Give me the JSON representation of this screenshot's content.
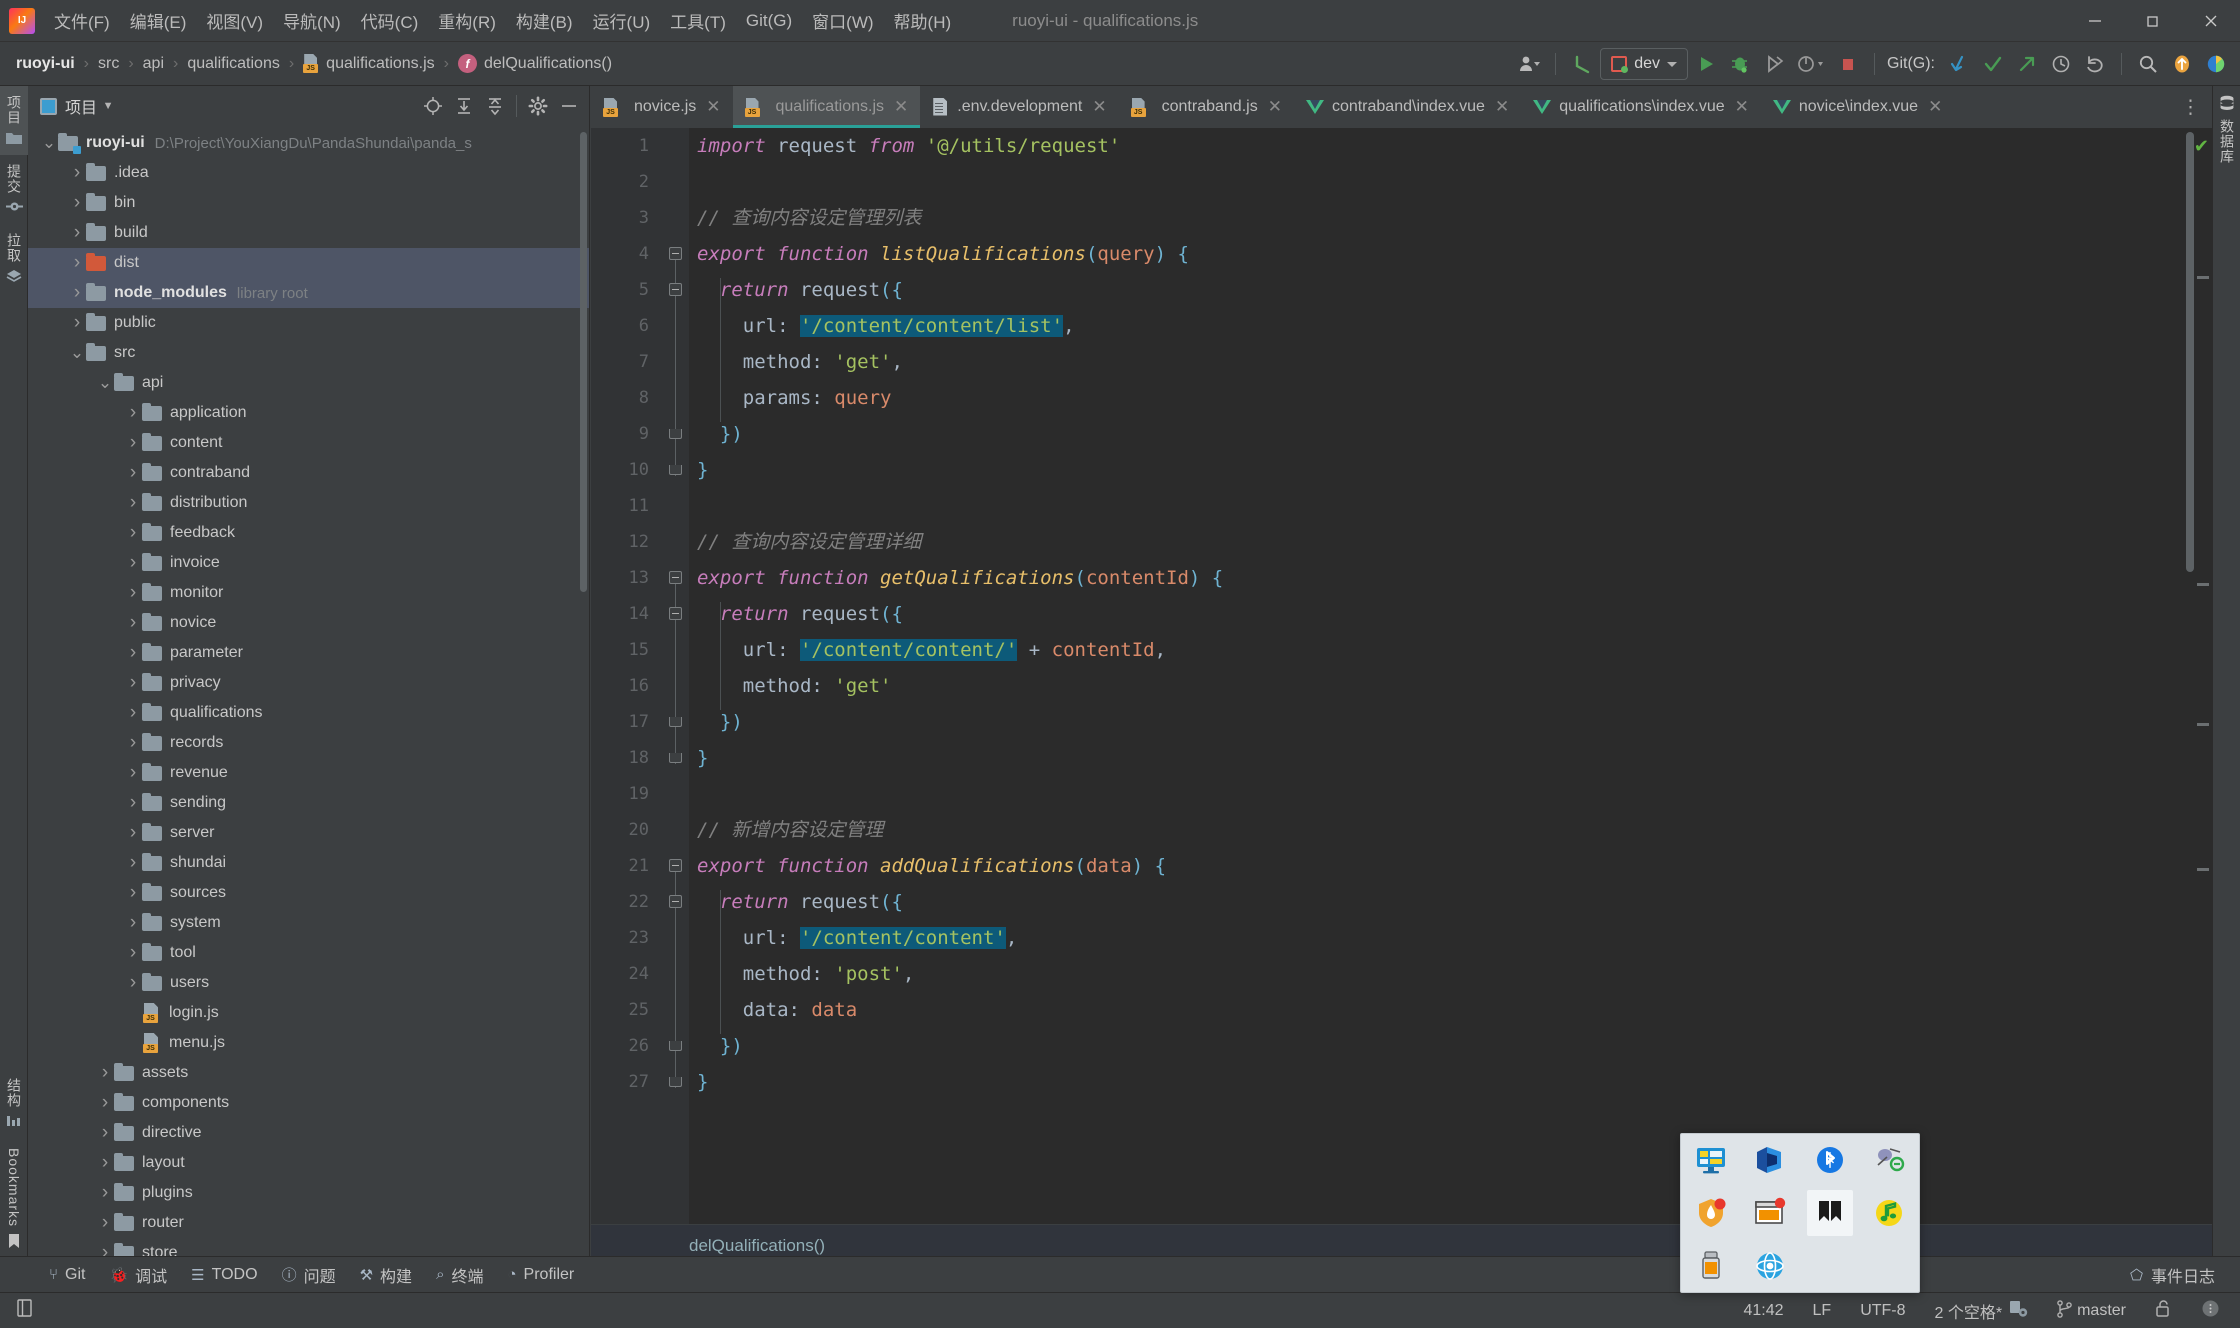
{
  "window": {
    "title": "ruoyi-ui - qualifications.js",
    "logo_icon": "intellij-idea-logo",
    "minimize_label": "–",
    "maximize_label": "❐",
    "close_label": "✕"
  },
  "menubar": {
    "items": [
      {
        "label": "文件(F)",
        "name": "menu-file"
      },
      {
        "label": "编辑(E)",
        "name": "menu-edit"
      },
      {
        "label": "视图(V)",
        "name": "menu-view"
      },
      {
        "label": "导航(N)",
        "name": "menu-navigate"
      },
      {
        "label": "代码(C)",
        "name": "menu-code"
      },
      {
        "label": "重构(R)",
        "name": "menu-refactor"
      },
      {
        "label": "构建(B)",
        "name": "menu-build"
      },
      {
        "label": "运行(U)",
        "name": "menu-run"
      },
      {
        "label": "工具(T)",
        "name": "menu-tools"
      },
      {
        "label": "Git(G)",
        "name": "menu-git"
      },
      {
        "label": "窗口(W)",
        "name": "menu-window"
      },
      {
        "label": "帮助(H)",
        "name": "menu-help"
      }
    ]
  },
  "breadcrumb": {
    "items": [
      {
        "label": "ruoyi-ui",
        "name": "breadcrumb-project",
        "bold": true
      },
      {
        "label": "src",
        "name": "breadcrumb-src"
      },
      {
        "label": "api",
        "name": "breadcrumb-api"
      },
      {
        "label": "qualifications",
        "name": "breadcrumb-qualifications"
      },
      {
        "label": "qualifications.js",
        "name": "breadcrumb-file"
      },
      {
        "label": "delQualifications()",
        "name": "breadcrumb-function"
      }
    ],
    "separator": "›"
  },
  "toolbar": {
    "run_config": "dev",
    "git_label": "Git(G):",
    "icons": {
      "account": "user-account-icon",
      "back_arrow": "back-arrow-icon",
      "run": "run-icon",
      "debug": "debug-icon",
      "coverage": "run-with-coverage-icon",
      "profile": "profile-icon",
      "stop": "stop-icon",
      "update": "git-update-icon",
      "commit": "git-commit-icon",
      "push": "git-push-icon",
      "history": "git-history-icon",
      "rollback": "git-rollback-icon",
      "search": "search-everywhere-icon",
      "updates": "updates-available-icon",
      "ai": "ai-assistant-icon"
    }
  },
  "left_strip": {
    "tabs": [
      {
        "label": "项目",
        "name": "tool-tab-project",
        "icon": "project-folder-icon",
        "active": true
      },
      {
        "label": "提交",
        "name": "tool-tab-commit",
        "icon": "commit-icon",
        "active": false
      },
      {
        "label": "拉取",
        "name": "tool-tab-pull-requests",
        "icon": "pull-requests-icon",
        "active": false
      }
    ],
    "bottom_tabs": [
      {
        "label": "结构",
        "name": "tool-tab-structure",
        "icon": "structure-icon"
      },
      {
        "label": "Bookmarks",
        "name": "tool-tab-bookmarks",
        "icon": "bookmark-icon"
      }
    ]
  },
  "right_strip": {
    "tabs": [
      {
        "label": "数据库",
        "name": "tool-tab-database",
        "icon": "database-icon"
      }
    ]
  },
  "project_panel": {
    "title": "项目",
    "icon": "project-panel-icon",
    "dropdown_icon": "chevron-down-icon",
    "actions": [
      {
        "name": "scroll-from-source-button",
        "icon": "target-icon",
        "glyph": "⊕"
      },
      {
        "name": "expand-all-button",
        "icon": "expand-all-icon",
        "glyph": "⤓"
      },
      {
        "name": "collapse-all-button",
        "icon": "collapse-all-icon",
        "glyph": "⤒"
      },
      {
        "name": "panel-settings-button",
        "icon": "gear-icon",
        "glyph": "⚙"
      },
      {
        "name": "hide-panel-button",
        "icon": "minimize-icon",
        "glyph": "—"
      }
    ],
    "tree": [
      {
        "label": "ruoyi-ui",
        "suffix": "D:\\Project\\YouXiangDu\\PandaShundai\\panda_s",
        "indent": 0,
        "arrow": "expanded",
        "icon": "project-root-folder",
        "bold": true
      },
      {
        "label": ".idea",
        "indent": 1,
        "arrow": "collapsed",
        "icon": "folder"
      },
      {
        "label": "bin",
        "indent": 1,
        "arrow": "collapsed",
        "icon": "folder"
      },
      {
        "label": "build",
        "indent": 1,
        "arrow": "collapsed",
        "icon": "folder"
      },
      {
        "label": "dist",
        "indent": 1,
        "arrow": "collapsed",
        "icon": "folder-excluded",
        "selected": true
      },
      {
        "label": "node_modules",
        "suffix": "library root",
        "indent": 1,
        "arrow": "collapsed",
        "icon": "folder",
        "bold": true,
        "selected": true
      },
      {
        "label": "public",
        "indent": 1,
        "arrow": "collapsed",
        "icon": "folder"
      },
      {
        "label": "src",
        "indent": 1,
        "arrow": "expanded",
        "icon": "folder"
      },
      {
        "label": "api",
        "indent": 2,
        "arrow": "expanded",
        "icon": "folder"
      },
      {
        "label": "application",
        "indent": 3,
        "arrow": "collapsed",
        "icon": "folder"
      },
      {
        "label": "content",
        "indent": 3,
        "arrow": "collapsed",
        "icon": "folder"
      },
      {
        "label": "contraband",
        "indent": 3,
        "arrow": "collapsed",
        "icon": "folder"
      },
      {
        "label": "distribution",
        "indent": 3,
        "arrow": "collapsed",
        "icon": "folder"
      },
      {
        "label": "feedback",
        "indent": 3,
        "arrow": "collapsed",
        "icon": "folder"
      },
      {
        "label": "invoice",
        "indent": 3,
        "arrow": "collapsed",
        "icon": "folder"
      },
      {
        "label": "monitor",
        "indent": 3,
        "arrow": "collapsed",
        "icon": "folder"
      },
      {
        "label": "novice",
        "indent": 3,
        "arrow": "collapsed",
        "icon": "folder"
      },
      {
        "label": "parameter",
        "indent": 3,
        "arrow": "collapsed",
        "icon": "folder"
      },
      {
        "label": "privacy",
        "indent": 3,
        "arrow": "collapsed",
        "icon": "folder"
      },
      {
        "label": "qualifications",
        "indent": 3,
        "arrow": "collapsed",
        "icon": "folder"
      },
      {
        "label": "records",
        "indent": 3,
        "arrow": "collapsed",
        "icon": "folder"
      },
      {
        "label": "revenue",
        "indent": 3,
        "arrow": "collapsed",
        "icon": "folder"
      },
      {
        "label": "sending",
        "indent": 3,
        "arrow": "collapsed",
        "icon": "folder"
      },
      {
        "label": "server",
        "indent": 3,
        "arrow": "collapsed",
        "icon": "folder"
      },
      {
        "label": "shundai",
        "indent": 3,
        "arrow": "collapsed",
        "icon": "folder"
      },
      {
        "label": "sources",
        "indent": 3,
        "arrow": "collapsed",
        "icon": "folder"
      },
      {
        "label": "system",
        "indent": 3,
        "arrow": "collapsed",
        "icon": "folder"
      },
      {
        "label": "tool",
        "indent": 3,
        "arrow": "collapsed",
        "icon": "folder"
      },
      {
        "label": "users",
        "indent": 3,
        "arrow": "collapsed",
        "icon": "folder"
      },
      {
        "label": "login.js",
        "indent": 3,
        "arrow": "none",
        "icon": "js-file"
      },
      {
        "label": "menu.js",
        "indent": 3,
        "arrow": "none",
        "icon": "js-file"
      },
      {
        "label": "assets",
        "indent": 2,
        "arrow": "collapsed",
        "icon": "folder"
      },
      {
        "label": "components",
        "indent": 2,
        "arrow": "collapsed",
        "icon": "folder"
      },
      {
        "label": "directive",
        "indent": 2,
        "arrow": "collapsed",
        "icon": "folder"
      },
      {
        "label": "layout",
        "indent": 2,
        "arrow": "collapsed",
        "icon": "folder"
      },
      {
        "label": "plugins",
        "indent": 2,
        "arrow": "collapsed",
        "icon": "folder"
      },
      {
        "label": "router",
        "indent": 2,
        "arrow": "collapsed",
        "icon": "folder"
      },
      {
        "label": "store",
        "indent": 2,
        "arrow": "collapsed",
        "icon": "folder"
      }
    ]
  },
  "editor": {
    "tabs": [
      {
        "label": "novice.js",
        "icon": "js-file",
        "active": false
      },
      {
        "label": "qualifications.js",
        "icon": "js-file",
        "active": true
      },
      {
        "label": ".env.development",
        "icon": "text-file",
        "active": false
      },
      {
        "label": "contraband.js",
        "icon": "js-file",
        "active": false
      },
      {
        "label": "contraband\\index.vue",
        "icon": "vue-file",
        "active": false
      },
      {
        "label": "qualifications\\index.vue",
        "icon": "vue-file",
        "active": false
      },
      {
        "label": "novice\\index.vue",
        "icon": "vue-file",
        "active": false
      }
    ],
    "close_glyph": "✕",
    "more_tabs_glyph": "⋮",
    "inspection_ok_glyph": "✔",
    "bottom_breadcrumb": "delQualifications()",
    "line_numbers": [
      1,
      2,
      3,
      4,
      5,
      6,
      7,
      8,
      9,
      10,
      11,
      12,
      13,
      14,
      15,
      16,
      17,
      18,
      19,
      20,
      21,
      22,
      23,
      24,
      25,
      26,
      27
    ],
    "code_lines": [
      [
        {
          "t": "import ",
          "c": "kw2"
        },
        {
          "t": "request ",
          "c": "ident"
        },
        {
          "t": "from ",
          "c": "kw2"
        },
        {
          "t": "'@/utils/request'",
          "c": "str"
        }
      ],
      [],
      [
        {
          "t": "// 查询内容设定管理列表",
          "c": "com"
        }
      ],
      [
        {
          "t": "export ",
          "c": "kw2"
        },
        {
          "t": "function ",
          "c": "kw2"
        },
        {
          "t": "listQualifications",
          "c": "fn"
        },
        {
          "t": "(",
          "c": "punc"
        },
        {
          "t": "query",
          "c": "param"
        },
        {
          "t": ") ",
          "c": "punc"
        },
        {
          "t": "{",
          "c": "punc"
        }
      ],
      [
        {
          "t": "  return ",
          "c": "kw2"
        },
        {
          "t": "request",
          "c": "ident"
        },
        {
          "t": "({",
          "c": "punc"
        }
      ],
      [
        {
          "t": "    url: ",
          "c": "prop"
        },
        {
          "t": "'/content/content/list'",
          "c": "str",
          "hl": true
        },
        {
          "t": ",",
          "c": "prop"
        }
      ],
      [
        {
          "t": "    method: ",
          "c": "prop"
        },
        {
          "t": "'get'",
          "c": "str"
        },
        {
          "t": ",",
          "c": "prop"
        }
      ],
      [
        {
          "t": "    params: ",
          "c": "prop"
        },
        {
          "t": "query",
          "c": "var"
        }
      ],
      [
        {
          "t": "  })",
          "c": "punc"
        }
      ],
      [
        {
          "t": "}",
          "c": "punc"
        }
      ],
      [],
      [
        {
          "t": "// 查询内容设定管理详细",
          "c": "com"
        }
      ],
      [
        {
          "t": "export ",
          "c": "kw2"
        },
        {
          "t": "function ",
          "c": "kw2"
        },
        {
          "t": "getQualifications",
          "c": "fn"
        },
        {
          "t": "(",
          "c": "punc"
        },
        {
          "t": "contentId",
          "c": "param"
        },
        {
          "t": ") ",
          "c": "punc"
        },
        {
          "t": "{",
          "c": "punc"
        }
      ],
      [
        {
          "t": "  return ",
          "c": "kw2"
        },
        {
          "t": "request",
          "c": "ident"
        },
        {
          "t": "({",
          "c": "punc"
        }
      ],
      [
        {
          "t": "    url: ",
          "c": "prop"
        },
        {
          "t": "'/content/content/'",
          "c": "str",
          "hl": true
        },
        {
          "t": " + ",
          "c": "prop"
        },
        {
          "t": "contentId",
          "c": "var"
        },
        {
          "t": ",",
          "c": "prop"
        }
      ],
      [
        {
          "t": "    method: ",
          "c": "prop"
        },
        {
          "t": "'get'",
          "c": "str"
        }
      ],
      [
        {
          "t": "  })",
          "c": "punc"
        }
      ],
      [
        {
          "t": "}",
          "c": "punc"
        }
      ],
      [],
      [
        {
          "t": "// 新增内容设定管理",
          "c": "com"
        }
      ],
      [
        {
          "t": "export ",
          "c": "kw2"
        },
        {
          "t": "function ",
          "c": "kw2"
        },
        {
          "t": "addQualifications",
          "c": "fn"
        },
        {
          "t": "(",
          "c": "punc"
        },
        {
          "t": "data",
          "c": "param"
        },
        {
          "t": ") ",
          "c": "punc"
        },
        {
          "t": "{",
          "c": "punc"
        }
      ],
      [
        {
          "t": "  return ",
          "c": "kw2"
        },
        {
          "t": "request",
          "c": "ident"
        },
        {
          "t": "({",
          "c": "punc"
        }
      ],
      [
        {
          "t": "    url: ",
          "c": "prop"
        },
        {
          "t": "'/content/content'",
          "c": "str",
          "hl": true
        },
        {
          "t": ",",
          "c": "prop"
        }
      ],
      [
        {
          "t": "    method: ",
          "c": "prop"
        },
        {
          "t": "'post'",
          "c": "str"
        },
        {
          "t": ",",
          "c": "prop"
        }
      ],
      [
        {
          "t": "    data: ",
          "c": "prop"
        },
        {
          "t": "data",
          "c": "var"
        }
      ],
      [
        {
          "t": "  })",
          "c": "punc"
        }
      ],
      [
        {
          "t": "}",
          "c": "punc"
        }
      ]
    ]
  },
  "bottom_tools": {
    "items": [
      {
        "label": "Git",
        "name": "bottom-tab-git",
        "glyph": "⑂"
      },
      {
        "label": "调试",
        "name": "bottom-tab-debug",
        "glyph": "🐞"
      },
      {
        "label": "TODO",
        "name": "bottom-tab-todo",
        "glyph": "☰"
      },
      {
        "label": "问题",
        "name": "bottom-tab-problems",
        "glyph": "ⓘ"
      },
      {
        "label": "构建",
        "name": "bottom-tab-build",
        "glyph": "⚒"
      },
      {
        "label": "终端",
        "name": "bottom-tab-terminal",
        "glyph": "⌕"
      },
      {
        "label": "Profiler",
        "name": "bottom-tab-profiler",
        "glyph": "◔"
      }
    ],
    "event_log": "事件日志",
    "event_log_glyph": "⬠"
  },
  "statusbar": {
    "caret_position": "41:42",
    "line_separator": "LF",
    "encoding": "UTF-8",
    "indent": "2 个空格*",
    "branch": "master",
    "indent_icon": "indent-settings-icon",
    "branch_icon": "git-branch-icon",
    "lock_icon": "unlocked-icon",
    "more_icon": "more-options-icon",
    "left_icon": "show-tool-windows-icon"
  },
  "tray_popup": {
    "icons": [
      {
        "name": "display-settings-icon",
        "row": 0,
        "col": 0
      },
      {
        "name": "nvidia-icon",
        "row": 0,
        "col": 1
      },
      {
        "name": "bluetooth-icon",
        "row": 0,
        "col": 2
      },
      {
        "name": "network-tools-icon",
        "row": 0,
        "col": 3
      },
      {
        "name": "security-shield-icon",
        "row": 1,
        "col": 0
      },
      {
        "name": "update-window-icon",
        "row": 1,
        "col": 1
      },
      {
        "name": "ribbon-app-icon",
        "row": 1,
        "col": 2,
        "selected": true
      },
      {
        "name": "music-note-icon",
        "row": 1,
        "col": 3
      },
      {
        "name": "usb-device-icon",
        "row": 2,
        "col": 0
      },
      {
        "name": "globe-app-icon",
        "row": 2,
        "col": 1
      }
    ]
  },
  "colors": {
    "accent": "#2aa198",
    "editor_bg": "#2b2b2b",
    "panel_bg": "#3c3f41",
    "selection": "#4e5566",
    "string": "#a5c261",
    "keyword": "#cc7832",
    "function": "#e8bf6a",
    "highlight": "#0d5a79"
  }
}
